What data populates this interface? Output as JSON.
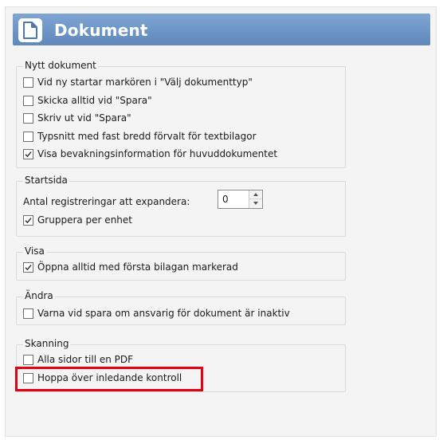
{
  "header": {
    "title": "Dokument",
    "icon": "document-icon",
    "color": "#6d95c6"
  },
  "groups": {
    "nytt": {
      "label": "Nytt dokument",
      "items": [
        {
          "label": "Vid ny startar markören i \"Välj dokumenttyp\"",
          "checked": false
        },
        {
          "label": "Skicka alltid vid \"Spara\"",
          "checked": false
        },
        {
          "label": "Skriv ut vid \"Spara\"",
          "checked": false
        },
        {
          "label": "Typsnitt med fast bredd förvalt för textbilagor",
          "checked": false
        },
        {
          "label": "Visa bevakningsinformation för huvuddokumentet",
          "checked": true
        }
      ]
    },
    "startsida": {
      "label": "Startsida",
      "expand_label": "Antal registreringar att expandera:",
      "expand_value": "0",
      "items": [
        {
          "label": "Gruppera per enhet",
          "checked": true
        }
      ]
    },
    "visa": {
      "label": "Visa",
      "items": [
        {
          "label": "Öppna alltid med första bilagan markerad",
          "checked": true
        }
      ]
    },
    "andra": {
      "label": "Ändra",
      "items": [
        {
          "label": "Varna vid spara om ansvarig för dokument är inaktiv",
          "checked": false
        }
      ]
    },
    "skanning": {
      "label": "Skanning",
      "items": [
        {
          "label": "Alla sidor till en PDF",
          "checked": false
        },
        {
          "label": "Hoppa över inledande kontroll",
          "checked": false
        }
      ]
    }
  },
  "highlight_color": "#e3000f"
}
